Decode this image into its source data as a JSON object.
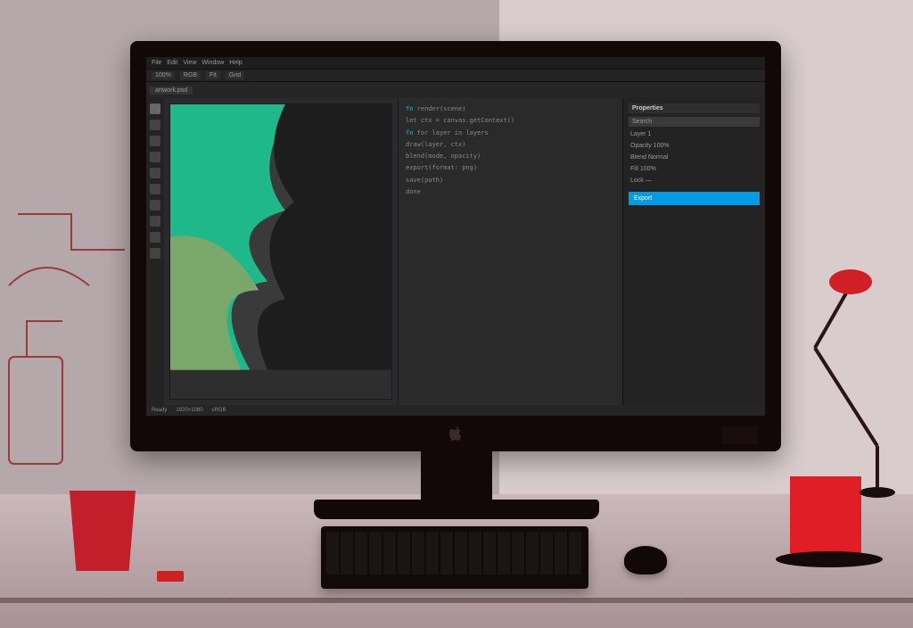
{
  "scene_description": "Stylized illustration of a desktop computer on a desk showing a dark creative/code editor application, with keyboard, mouse, red cups, and a desk lamp.",
  "editor": {
    "menu": [
      "File",
      "Edit",
      "View",
      "Window",
      "Help"
    ],
    "options": [
      "100%",
      "RGB",
      "Fit",
      "Grid"
    ],
    "tabs": [
      "artwork.psd"
    ],
    "tools": [
      "move",
      "select",
      "brush",
      "eraser",
      "text",
      "shape",
      "eyedrop",
      "crop",
      "hand",
      "zoom"
    ],
    "side_header": "Properties",
    "side_lines": [
      "Layer 1",
      "Opacity 100%",
      "Blend Normal",
      "Fill 100%",
      "Lock —"
    ],
    "side_input": "Search",
    "cta": "Export",
    "status": [
      "Ready",
      "1920×1080",
      "sRGB"
    ],
    "code_prefix": "fn",
    "code_lines": [
      "render(scene)",
      "let ctx = canvas.getContext()",
      "for layer in layers",
      "draw(layer, ctx)",
      "blend(mode, opacity)",
      "export(format: png)",
      "save(path)",
      "done"
    ]
  }
}
